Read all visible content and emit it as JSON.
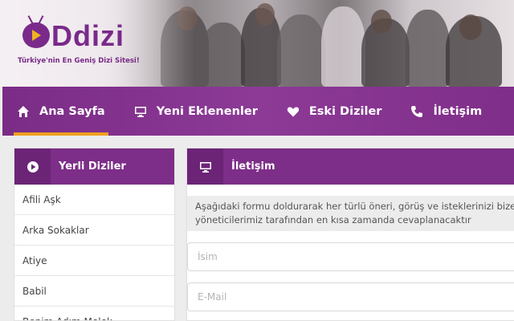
{
  "brand": {
    "logo_text": "Ddizi",
    "tagline": "Türkiye'nin En Geniş Dizi Sitesi!"
  },
  "nav": {
    "items": [
      {
        "label": "Ana Sayfa",
        "icon": "home-icon",
        "active": true
      },
      {
        "label": "Yeni Eklenenler",
        "icon": "monitor-icon",
        "active": false
      },
      {
        "label": "Eski Diziler",
        "icon": "heart-icon",
        "active": false
      },
      {
        "label": "İletişim",
        "icon": "phone-icon",
        "active": false
      }
    ]
  },
  "sidebar": {
    "title": "Yerli Diziler",
    "icon": "play-circle-icon",
    "items": [
      {
        "label": "Afili Aşk"
      },
      {
        "label": "Arka Sokaklar"
      },
      {
        "label": "Atiye"
      },
      {
        "label": "Babil"
      },
      {
        "label": "Benim Adım Melek"
      }
    ]
  },
  "contact": {
    "title": "İletişim",
    "icon": "monitor-icon",
    "intro_line1": "Aşağıdaki formu doldurarak her türlü öneri, görüş ve isteklerinizi bize",
    "intro_line2": "yöneticilerimiz tarafından en kısa zamanda cevaplanacaktır",
    "name_placeholder": "İsim",
    "email_placeholder": "E-Mail"
  },
  "colors": {
    "brand_purple": "#7d2e88",
    "accent_orange": "#f0a020"
  }
}
